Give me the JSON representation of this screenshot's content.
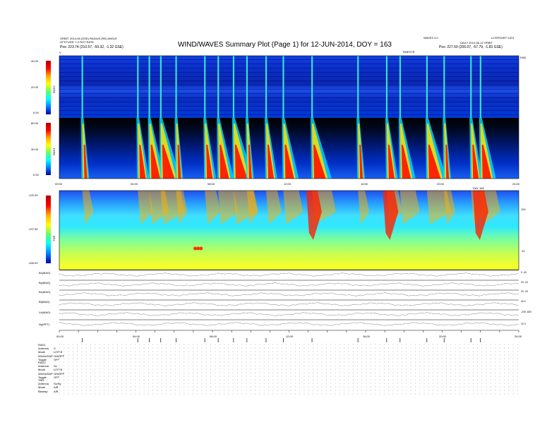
{
  "header": {
    "left_lines": [
      "ORBIT: 2014-06 (GSE) RADIUS (RE) ANGLE",
      "ATTITUDE: 1.2 ROT RATE",
      "Pos:"
    ],
    "left_pos_values": "223.74 (210.57, -59.32, -1.32 GSE)",
    "title": "WIND/WAVES Summary Plot (Page 1) for 12-JUN-2014, DOY = 163",
    "right_lines": [
      "WAVES 3.0",
      "DAILY 2014-06-12 ORBIT",
      "Pos:"
    ],
    "right_code": "L2:ERSORT v.001",
    "right_pos_values": "227.50 (206.07, -57.79, -1.83 GSE)",
    "top_center_tag": "TIMESTR",
    "top_right_tag": "END",
    "top_left_tag": "V"
  },
  "panels": {
    "rad2": {
      "label": "RAD2",
      "ticks": [
        "40.00",
        "20.00",
        "0.00"
      ]
    },
    "rad1": {
      "label": "RAD1",
      "ticks": [
        "80.00",
        "30.00",
        "0.00"
      ]
    },
    "tnr": {
      "label": "TNR",
      "ticks": [
        "-120.00",
        "-137.50",
        "-155.00"
      ],
      "right_ticks": [
        "100",
        "10"
      ]
    }
  },
  "time_axis": {
    "ticks": [
      "00:00",
      "04:00",
      "08:00",
      "12:00",
      "16:00",
      "20:00",
      "24:00"
    ],
    "mid_tag": "DAY 163"
  },
  "traces": [
    {
      "label": "Bx(MAG)",
      "right": "0 -40"
    },
    {
      "label": "By(MAG)",
      "right": "20 -20"
    },
    {
      "label": "Bz(MAG)",
      "right": "20 -20"
    },
    {
      "label": "Bt(MAG)",
      "right": "40 0"
    },
    {
      "label": "Vx(MAG)",
      "right": "-200 -600"
    },
    {
      "label": "Np(PFT)",
      "right": "20 0"
    }
  ],
  "mode_blocks": [
    {
      "title": "RAD1",
      "rows": [
        [
          "Antenna",
          "S"
        ],
        [
          "Mode",
          "LIST B"
        ],
        [
          "32kHz/DAP",
          "ON/OFF"
        ],
        [
          "Toggle",
          "OFF"
        ]
      ]
    },
    {
      "title": "RAD2",
      "rows": [
        [
          "Antenna",
          "Sz"
        ],
        [
          "Mode",
          "LIST B"
        ],
        [
          "32kHz/DAP",
          "ON/OFF"
        ],
        [
          "Toggle",
          "OFF"
        ]
      ]
    },
    {
      "title": "TNR",
      "rows": [
        [
          "Antenna",
          "Sx/Sy"
        ],
        [
          "Mode",
          "A/B"
        ],
        [
          "Bandsp",
          "A/B"
        ]
      ]
    }
  ],
  "chart_data": {
    "type": "heatmap",
    "title": "WIND/WAVES Summary Plot (Page 1) for 12-JUN-2014, DOY = 163",
    "x_range_hours": [
      0,
      24
    ],
    "panels": [
      "RAD2",
      "RAD1",
      "TNR"
    ],
    "burst_times_hours": [
      1.2,
      4.1,
      4.7,
      5.3,
      6.1,
      7.6,
      8.3,
      9.1,
      9.8,
      10.8,
      11.7,
      13.2,
      15.6,
      17.1,
      17.8,
      19.2,
      20.1,
      21.5,
      22.0
    ],
    "colorbars": {
      "RAD2": [
        0,
        40
      ],
      "RAD1": [
        0,
        80
      ],
      "TNR": [
        -155,
        -120
      ]
    }
  }
}
